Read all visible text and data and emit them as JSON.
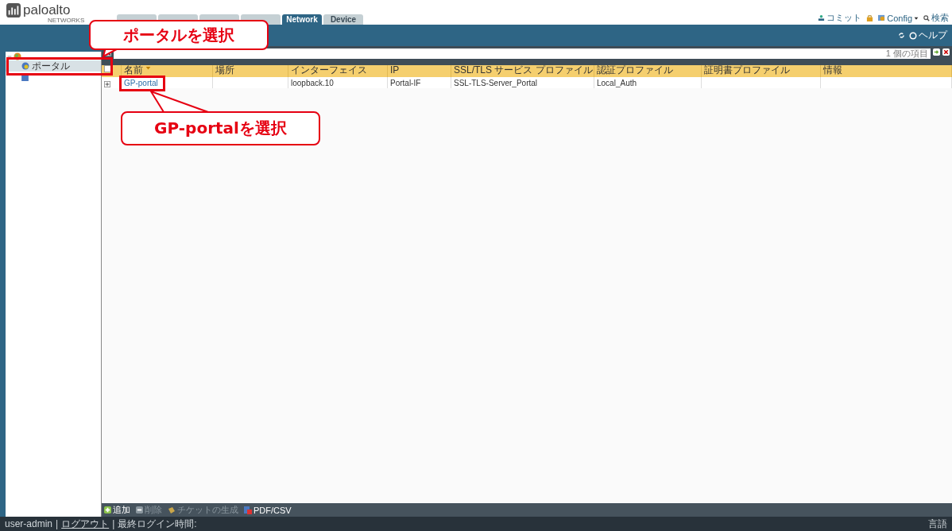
{
  "logo": {
    "name": "paloalto",
    "sub": "NETWORKS"
  },
  "tabs": [
    {
      "selected": false
    },
    {
      "selected": false
    },
    {
      "selected": false
    },
    {
      "selected": false
    },
    {
      "label": "Network",
      "selected": true
    },
    {
      "label": "Device",
      "selected": false
    }
  ],
  "top_actions": {
    "commit": "コミット",
    "config": "Config",
    "search": "検索"
  },
  "help": "ヘルプ",
  "sidebar": {
    "items": [
      {
        "expanded": true,
        "children": [
          {
            "label": "ポータル",
            "selected": true
          },
          {
            "selected": false
          }
        ]
      }
    ]
  },
  "filter": {
    "count": "1 個の項目"
  },
  "table": {
    "columns": [
      "名前",
      "場所",
      "インターフェイス",
      "IP",
      "SSL/TLS サービス プロファイル",
      "認証プロファイル",
      "証明書プロファイル",
      "情報"
    ],
    "rows": [
      {
        "cells": [
          "GP-portal",
          "",
          "loopback.10",
          "Portal-IF",
          "SSL-TLS-Server_Portal",
          "Local_Auth",
          "",
          ""
        ]
      }
    ]
  },
  "toolbar": [
    {
      "kind": "add",
      "label": "追加",
      "disabled": false
    },
    {
      "kind": "delete",
      "label": "削除",
      "disabled": true
    },
    {
      "kind": "ticket",
      "label": "チケットの生成",
      "disabled": true
    },
    {
      "kind": "pdf",
      "label": "PDF/CSV",
      "disabled": false
    }
  ],
  "status_bar": {
    "user": "user-admin",
    "separators": [
      "|",
      "|"
    ],
    "logout": "ログアウト",
    "last_login": "最終ログイン時間:",
    "language": "言語"
  },
  "callouts": [
    {
      "text": "ポータルを選択"
    },
    {
      "text": "GP-portalを選択"
    }
  ]
}
